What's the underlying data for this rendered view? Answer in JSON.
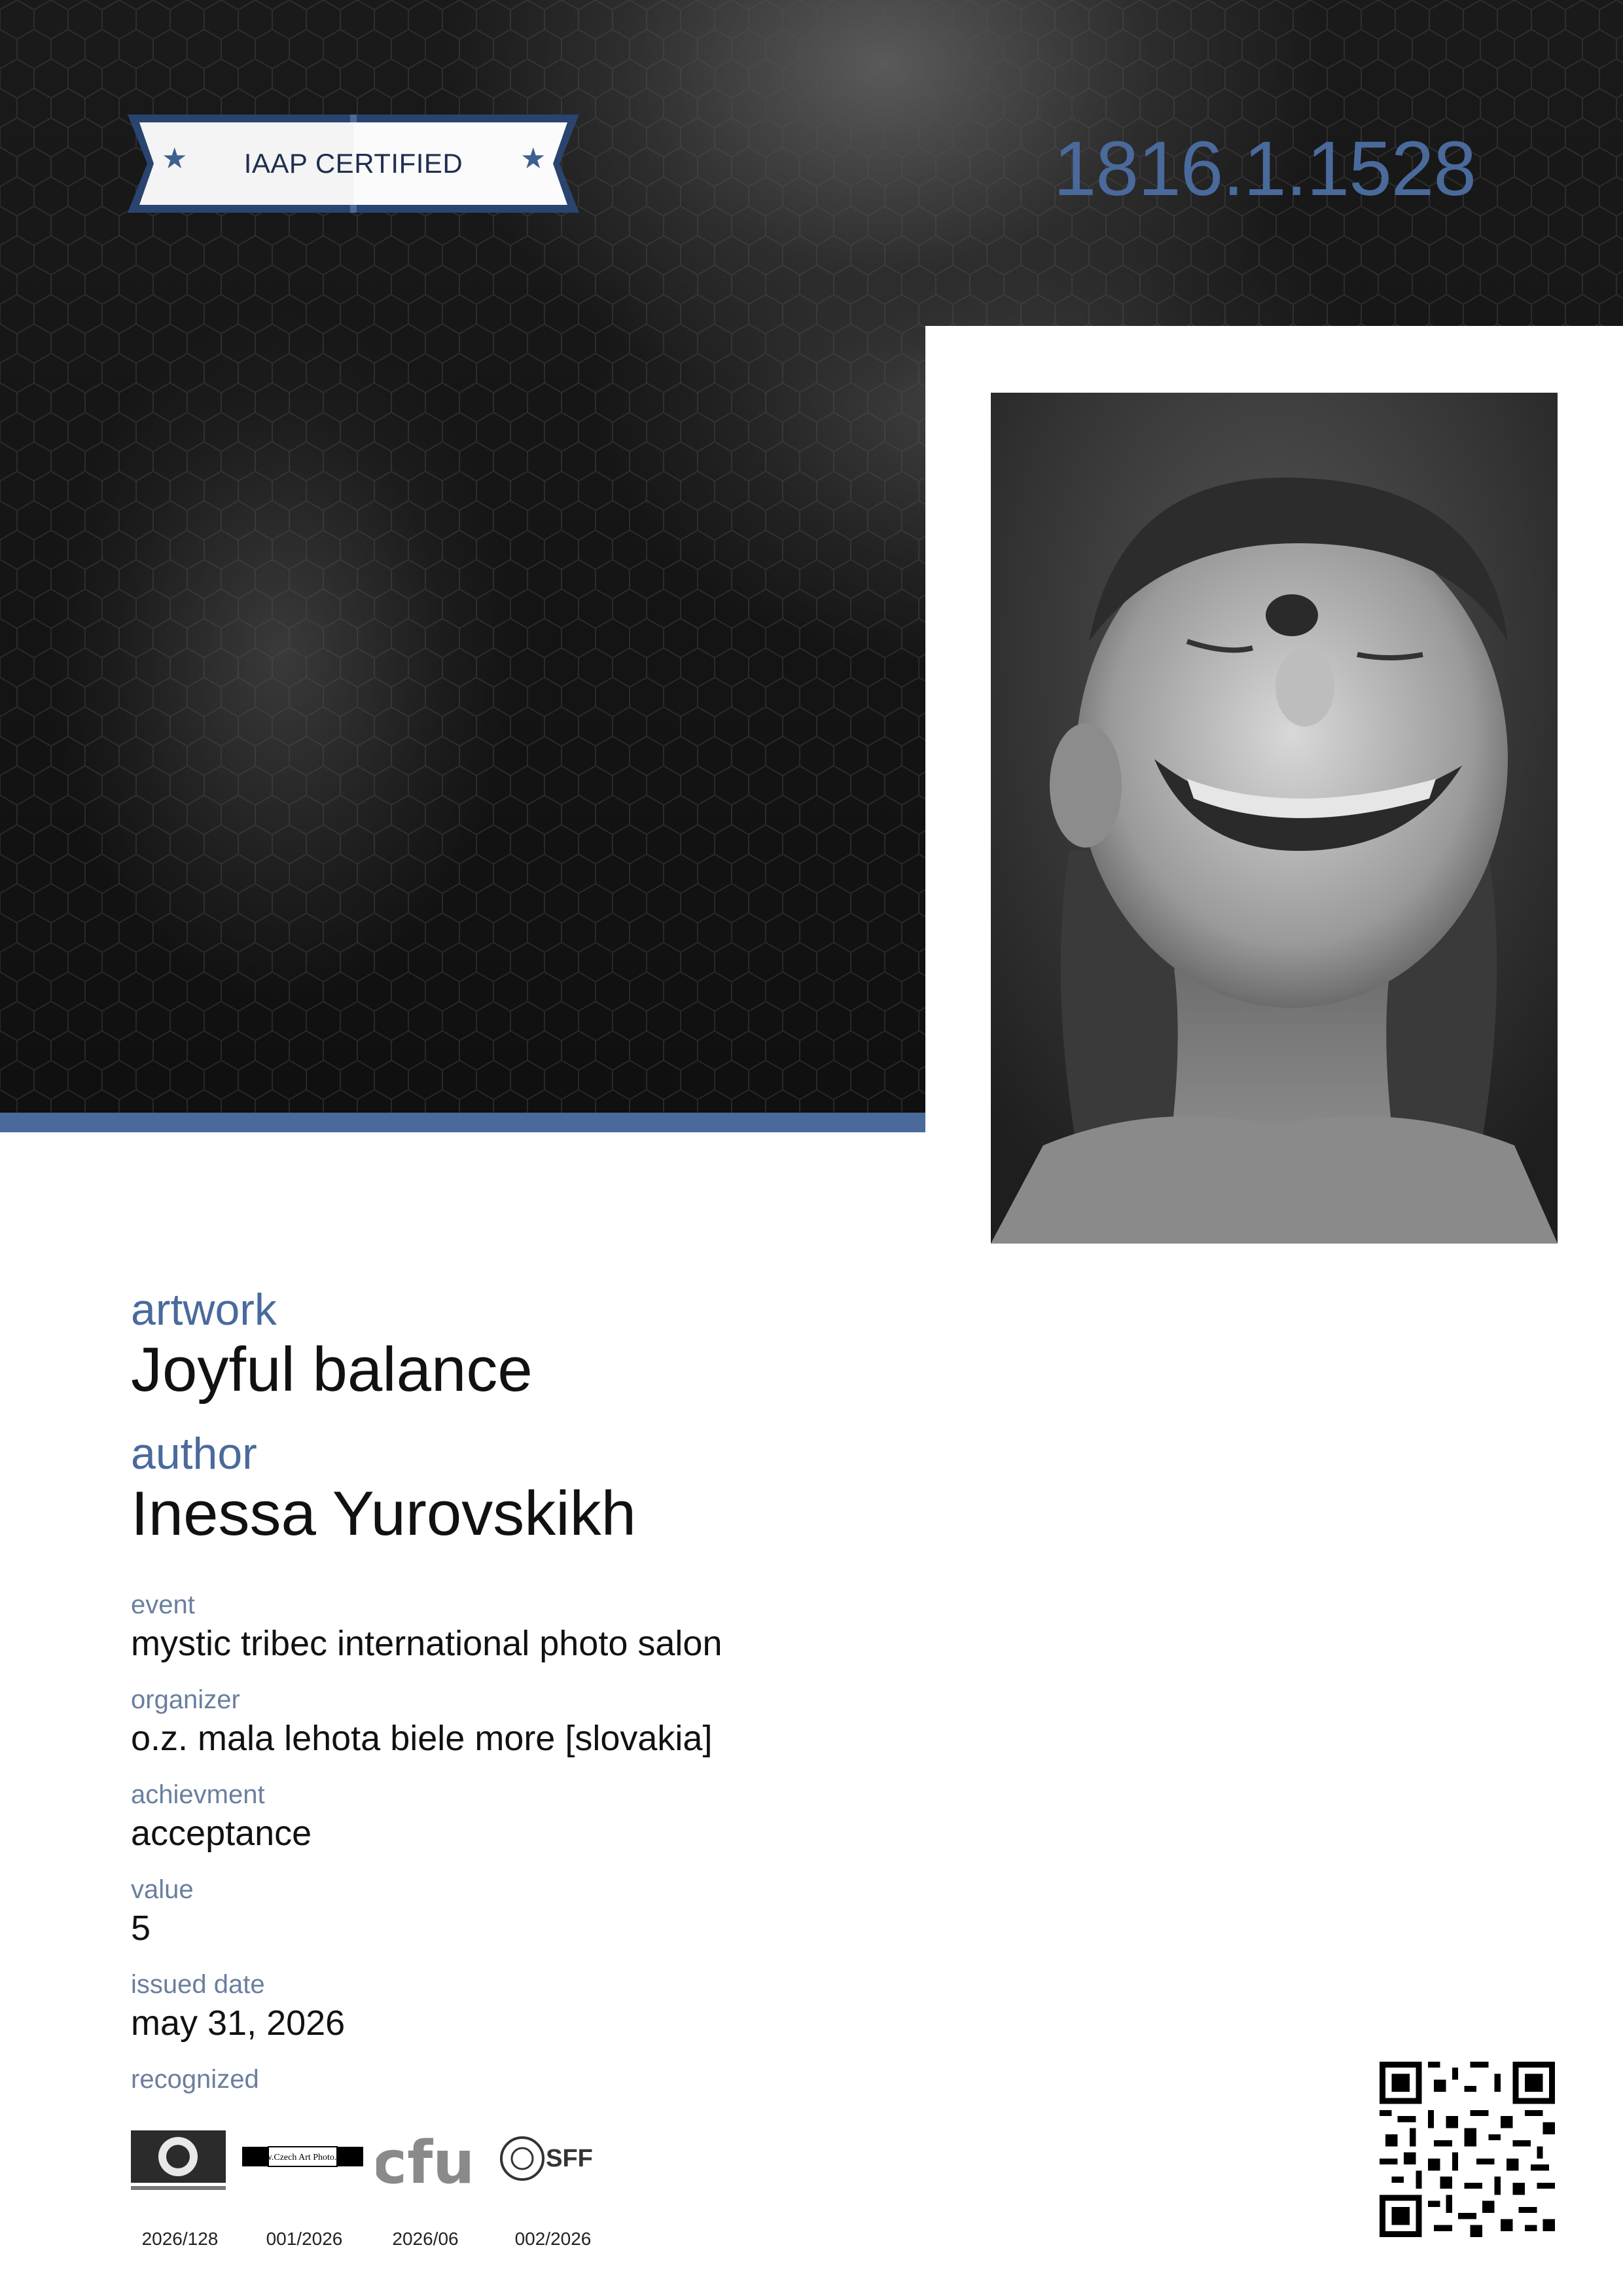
{
  "badge": {
    "label": "IAAP CERTIFIED"
  },
  "certificate_number": "1816.1.1528",
  "fields": {
    "artwork_label": "artwork",
    "artwork_value": "Joyful balance",
    "author_label": "author",
    "author_value": "Inessa Yurovskikh",
    "event_label": "event",
    "event_value": "mystic tribec international photo salon",
    "organizer_label": "organizer",
    "organizer_value": "o.z. mala lehota biele more [slovakia]",
    "achievement_label": "achievment",
    "achievement_value": "acceptance",
    "value_label": "value",
    "value_value": "5",
    "issued_label": "issued date",
    "issued_value": "may 31, 2026",
    "recognized_label": "recognized"
  },
  "recognitions": [
    {
      "name": "IAAP",
      "code": "2026/128"
    },
    {
      "name": "www.Czech Art Photo.com",
      "code": "001/2026"
    },
    {
      "name": "cfu",
      "code": "2026/06"
    },
    {
      "name": "SFF",
      "code": "002/2026"
    }
  ],
  "colors": {
    "accent": "#4a6a9c",
    "badge_navy": "#2a4470"
  }
}
